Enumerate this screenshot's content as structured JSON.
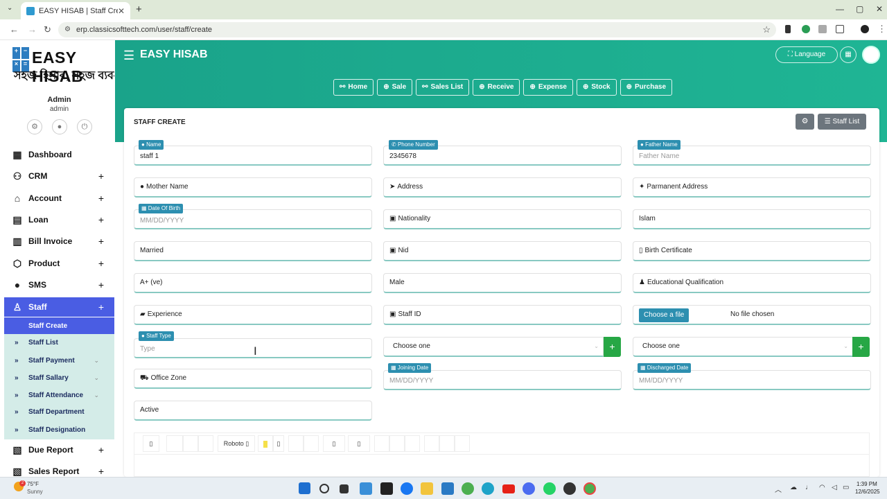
{
  "browser": {
    "tab_title": "EASY HISAB | Staff Create",
    "url": "erp.classicsofttech.com/user/staff/create"
  },
  "sidebar": {
    "logo_text": "EASY HISAB",
    "logo_tagline": "সহজ হিসাব, সহজ ব্যবসা",
    "user_name": "Admin",
    "user_role": "admin",
    "menu": [
      {
        "label": "Dashboard",
        "icon": "dashboard-icon",
        "plus": ""
      },
      {
        "label": "CRM",
        "icon": "users-icon",
        "plus": "+"
      },
      {
        "label": "Account",
        "icon": "bank-icon",
        "plus": "+"
      },
      {
        "label": "Loan",
        "icon": "ledger-icon",
        "plus": "+"
      },
      {
        "label": "Bill Invoice",
        "icon": "book-icon",
        "plus": "+"
      },
      {
        "label": "Product",
        "icon": "box-icon",
        "plus": "+"
      },
      {
        "label": "SMS",
        "icon": "chat-icon",
        "plus": "+"
      },
      {
        "label": "Staff",
        "icon": "staff-icon",
        "plus": "+"
      }
    ],
    "staff_submenu": [
      {
        "label": "Staff Create",
        "caret": ""
      },
      {
        "label": "Staff List",
        "caret": ""
      },
      {
        "label": "Staff Payment",
        "caret": "⌄"
      },
      {
        "label": "Staff Sallary",
        "caret": "⌄"
      },
      {
        "label": "Staff Attendance",
        "caret": "⌄"
      },
      {
        "label": "Staff Department",
        "caret": ""
      },
      {
        "label": "Staff Designation",
        "caret": ""
      }
    ],
    "menu_after": [
      {
        "label": "Due Report",
        "icon": "report-icon",
        "plus": "+"
      },
      {
        "label": "Sales Report",
        "icon": "report-icon",
        "plus": "+"
      }
    ]
  },
  "header": {
    "brand": "EASY HISAB",
    "language_label": "Language",
    "quick_nav": [
      "Home",
      "Sale",
      "Sales List",
      "Receive",
      "Expense",
      "Stock",
      "Purchase"
    ]
  },
  "card": {
    "title": "STAFF CREATE",
    "staff_list_label": "Staff List"
  },
  "form": {
    "name_label": "Name",
    "name_value": "staff 1",
    "phone_label": "Phone Number",
    "phone_value": "2345678",
    "father_label": "Father Name",
    "father_placeholder": "Father Name",
    "mother_placeholder": "Mother Name",
    "address_placeholder": "Address",
    "permanent_address_placeholder": "Parmanent Address",
    "dob_label": "Date Of Birth",
    "dob_placeholder": "MM/DD/YYYY",
    "nationality_placeholder": "Nationality",
    "religion_value": "Islam",
    "marital_value": "Married",
    "nid_placeholder": "Nid",
    "birth_cert_placeholder": "Birth Certificate",
    "blood_value": "A+ (ve)",
    "gender_value": "Male",
    "education_placeholder": "Educational Qualification",
    "experience_placeholder": "Experience",
    "staff_id_placeholder": "Staff ID",
    "choose_file_label": "Choose a file",
    "no_file_text": "No file chosen",
    "staff_type_label": "Staff Type",
    "staff_type_placeholder": "Type",
    "select1_value": "Choose one",
    "select2_value": "Choose one",
    "office_zone_placeholder": "Office Zone",
    "joining_label": "Joining Date",
    "joining_placeholder": "MM/DD/YYYY",
    "discharged_label": "Discharged Date",
    "discharged_placeholder": "MM/DD/YYYY",
    "status_value": "Active"
  },
  "editor": {
    "font_label": "Roboto"
  },
  "taskbar": {
    "temperature": "75°F",
    "condition": "Sunny",
    "weather_badge": "2",
    "time": "1:39 PM",
    "date": "12/6/2025"
  },
  "colors": {
    "header_green": "#1aa38a",
    "active_menu": "#4a5de3",
    "label_blue": "#2d8fb0",
    "add_green": "#27a745"
  }
}
